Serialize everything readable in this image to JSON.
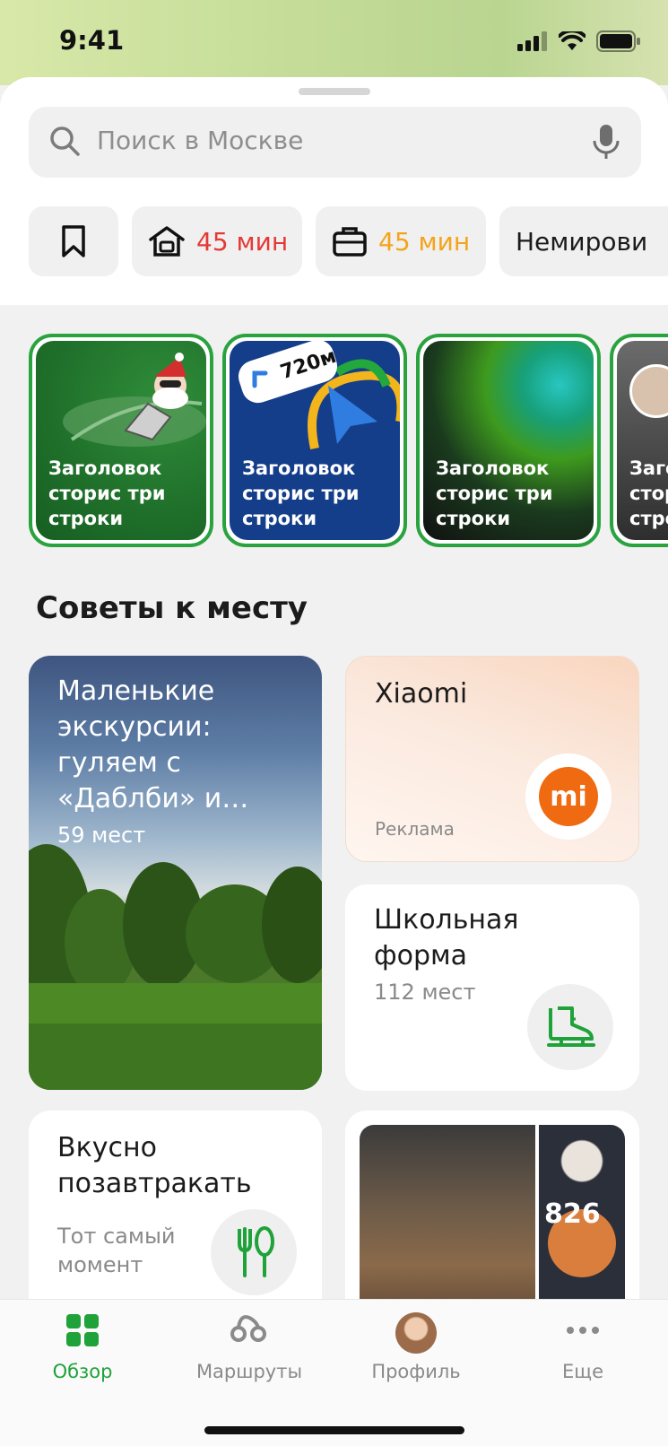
{
  "status_bar": {
    "time": "9:41"
  },
  "search": {
    "placeholder": "Поиск в Москве"
  },
  "chips": [
    {
      "icon": "bookmark-icon"
    },
    {
      "icon": "home-icon",
      "label": "45 мин",
      "color": "#e53935"
    },
    {
      "icon": "briefcase-icon",
      "label": "45 мин",
      "color": "#f4a41a"
    },
    {
      "label": "Немирови"
    }
  ],
  "stories": [
    {
      "title": "Заголовок сторис три строки"
    },
    {
      "title": "Заголовок сторис три строки",
      "badge": "720м"
    },
    {
      "title": "Заголовок сторис три строки"
    },
    {
      "title": "Заголовок сторис три строки"
    }
  ],
  "section": {
    "title": "Советы к месту"
  },
  "cards": {
    "excursions": {
      "title": "Маленькие экскурсии: гуляем с «Даблби» и…",
      "subtitle": "59 мест"
    },
    "xiaomi": {
      "title": "Xiaomi",
      "ad_label": "Реклама",
      "logo": "mi"
    },
    "school": {
      "title": "Школьная форма",
      "subtitle": "112 мест"
    },
    "breakfast": {
      "title": "Вкусно позавтракать",
      "subtitle": "Тот самый момент"
    },
    "photos": {
      "count": "826"
    }
  },
  "tabbar": {
    "items": [
      {
        "label": "Обзор",
        "active": true
      },
      {
        "label": "Маршруты"
      },
      {
        "label": "Профиль"
      },
      {
        "label": "Еще"
      }
    ]
  },
  "colors": {
    "accent": "#1fa23a",
    "route_red": "#e53935",
    "route_orange": "#f4a41a"
  }
}
